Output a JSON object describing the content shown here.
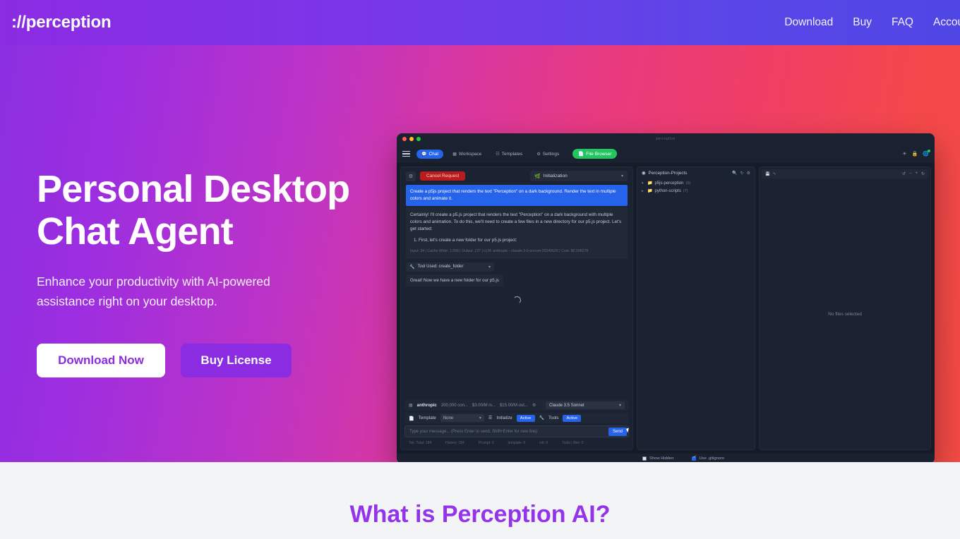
{
  "header": {
    "brand": "://perception",
    "nav": [
      {
        "label": "Download"
      },
      {
        "label": "Buy"
      },
      {
        "label": "FAQ"
      },
      {
        "label": "Account"
      }
    ]
  },
  "hero": {
    "title": "Personal Desktop Chat Agent",
    "subtitle": "Enhance your productivity with AI-powered assistance right on your desktop.",
    "primary_cta": "Download Now",
    "secondary_cta": "Buy License",
    "gradient_start": "#8b2fe0",
    "gradient_mid": "#e63a8a",
    "gradient_end": "#f24a44"
  },
  "app": {
    "window_title": "perception",
    "tabs": [
      {
        "label": "Chat",
        "icon": "chat-icon",
        "active": true
      },
      {
        "label": "Workspace",
        "icon": "workspace-icon",
        "active": false
      },
      {
        "label": "Templates",
        "icon": "templates-icon",
        "active": false
      },
      {
        "label": "Settings",
        "icon": "settings-icon",
        "active": false
      }
    ],
    "file_browser_button": "File Browser",
    "chat": {
      "cancel_button": "Cancel Request",
      "mode_select": "Initialization",
      "user_message": "Create a p5js project that renders the text \"Perception\" on a dark background. Render the text in multiple colors and animate it.",
      "ai_message": "Certainly! I'll create a p5.js project that renders the text \"Perception\" on a dark background with multiple colors and animation. To do this, we'll need to create a few files in a new directory for our p5.js project. Let's get started:",
      "ai_step": "First, let's create a new folder for our p5.js project:",
      "meta": "Input: 34 | Cache Write: 1,099 | Output: 137 | LLM: anthropic - claude-3-5-sonnet-20240620 | Cost: $0.008278",
      "tool_used": "Tool Used: create_folder",
      "tool_result": "Great! Now we have a new folder for our p5.js"
    },
    "model_bar": {
      "provider": "anthropic",
      "context": "200,000 con...",
      "input_price": "$3.00/M in...",
      "output_price": "$15.00/M out...",
      "model": "Claude 3.5 Sonnet"
    },
    "options_bar": {
      "template_label": "Template",
      "template_value": "None",
      "initialize_label": "Initialize",
      "initialize_state": "Active",
      "tools_label": "Tools",
      "tools_state": "Active"
    },
    "compose": {
      "placeholder": "Type your message... (Press Enter to send, Shift+Enter for new line)",
      "send_label": "Send"
    },
    "status_bar": [
      {
        "label": "Tok. Total: 184"
      },
      {
        "label": "History: 184"
      },
      {
        "label": "Prompt: 0"
      },
      {
        "label": "template: 0"
      },
      {
        "label": "init: 0"
      },
      {
        "label": "Tools | files: 0"
      }
    ],
    "files": {
      "title": "Perception-Projects",
      "tree": [
        {
          "name": "p5js-perception",
          "count": "(0)",
          "expanded": true
        },
        {
          "name": "python-scripts",
          "count": "(7)",
          "expanded": false
        }
      ],
      "empty_state": "No files selected",
      "show_hidden_label": "Show Hidden",
      "show_hidden_checked": false,
      "gitignore_label": "Use .gitignore",
      "gitignore_checked": true
    }
  },
  "section": {
    "title": "What is Perception AI?",
    "title_color": "#9333ea"
  }
}
